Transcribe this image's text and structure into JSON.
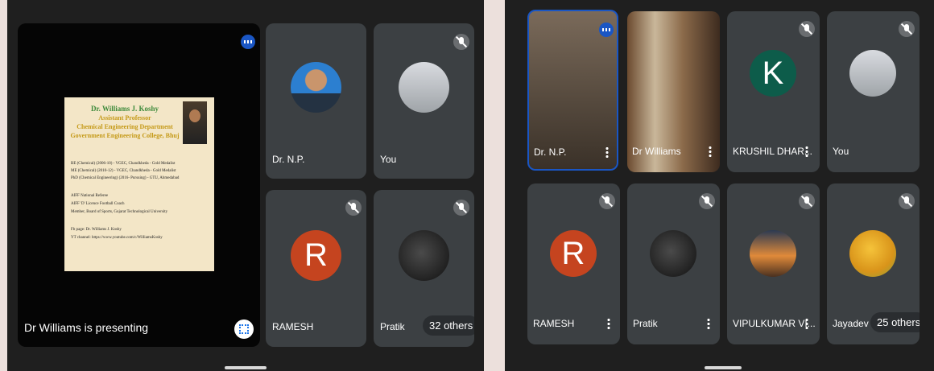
{
  "left_screen": {
    "presentation": {
      "label": "Dr Williams is presenting",
      "slide": {
        "title": "Dr. Williams J. Koshy",
        "subtitle1": "Assistant Professor",
        "subtitle2": "Chemical Engineering Department",
        "subtitle3": "Government Engineering College, Bhuj",
        "lines": [
          "BE (Chemical) (2006-10) - VGEC, Chandkheda - Gold Medalist",
          "ME (Chemical) (2010-12) - VGEC, Chandkheda - Gold Medalist",
          "PhD (Chemical Engineering) (2016- Pursuing) - GTU, Ahmedabad",
          "AIFF National Referee",
          "AIFF 'D' Licence Football Coach",
          "Member, Board of Sports, Gujarat Technological University",
          "Fb page: Dr. Williams J. Koshy",
          "YT channel: https://www.youtube.com/c/WilliamsKoshy"
        ]
      }
    },
    "tiles": [
      {
        "name": "Dr. N.P."
      },
      {
        "name": "You"
      },
      {
        "name": "RAMESH",
        "initial": "R"
      },
      {
        "name": "Pratik"
      }
    ],
    "others": "32 others"
  },
  "right_screen": {
    "tiles": [
      {
        "name": "Dr. N.P."
      },
      {
        "name": "Dr Williams"
      },
      {
        "name": "KRUSHIL DHAR...",
        "initial": "K"
      },
      {
        "name": "You"
      },
      {
        "name": "RAMESH",
        "initial": "R"
      },
      {
        "name": "Pratik"
      },
      {
        "name": "VIPULKUMAR VI..."
      },
      {
        "name": "Jayadev"
      }
    ],
    "others": "25 others"
  },
  "colors": {
    "ramesh_avatar": "#c5441f",
    "krushil_avatar": "#0d5c4a",
    "active_speaker_border": "#1a56c4",
    "tile_bg": "#3c4043",
    "background": "#1f1f1f"
  },
  "icons": [
    "mic-off-icon",
    "speaking-indicator-icon",
    "more-options-icon",
    "fullscreen-icon"
  ]
}
